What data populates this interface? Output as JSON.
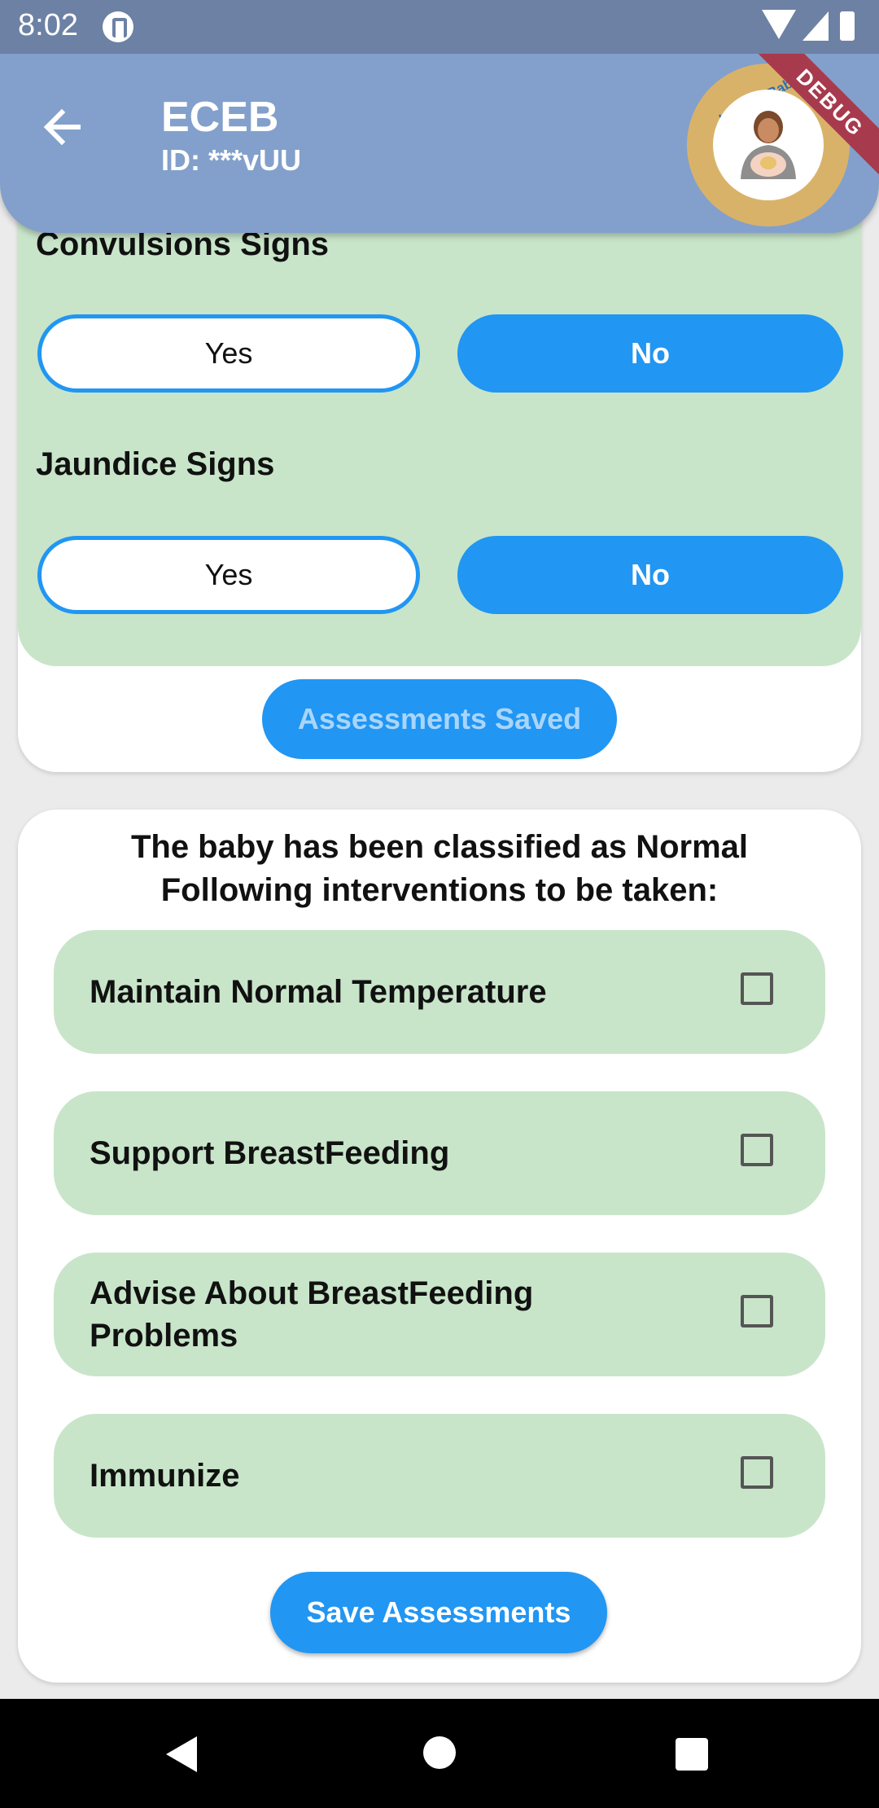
{
  "status_bar": {
    "time": "8:02",
    "icons": [
      "app-notification-icon",
      "wifi-icon",
      "signal-icon",
      "battery-icon"
    ]
  },
  "app_bar": {
    "title": "ECEB",
    "subtitle": "ID: ***vUU",
    "back_icon": "arrow-back-icon",
    "logo_text": "Helping Babies Survive",
    "debug_label": "DEBUG"
  },
  "assessment": {
    "questions": [
      {
        "label": "Convulsions Signs",
        "yes_label": "Yes",
        "no_label": "No",
        "selected": "No"
      },
      {
        "label": "Jaundice Signs",
        "yes_label": "Yes",
        "no_label": "No",
        "selected": "No"
      }
    ],
    "saved_button_label": "Assessments Saved"
  },
  "classification": {
    "line1": "The baby has been classified as Normal",
    "line2": "Following interventions to be taken:"
  },
  "interventions": [
    {
      "label": "Maintain Normal Temperature",
      "checked": false
    },
    {
      "label": "Support BreastFeeding",
      "checked": false
    },
    {
      "label": "Advise About BreastFeeding Problems",
      "checked": false
    },
    {
      "label": "Immunize",
      "checked": false
    }
  ],
  "save_button_label": "Save Assessments",
  "nav_bar": {
    "icons": [
      "back-triangle-icon",
      "home-circle-icon",
      "recents-square-icon"
    ]
  },
  "colors": {
    "status_bar": "#6c81a4",
    "app_bar": "#82a0cb",
    "accent_blue": "#2196f3",
    "panel_green": "#c8e5c9",
    "logo_ring": "#d9b26a",
    "debug_banner": "#a83a4d"
  }
}
